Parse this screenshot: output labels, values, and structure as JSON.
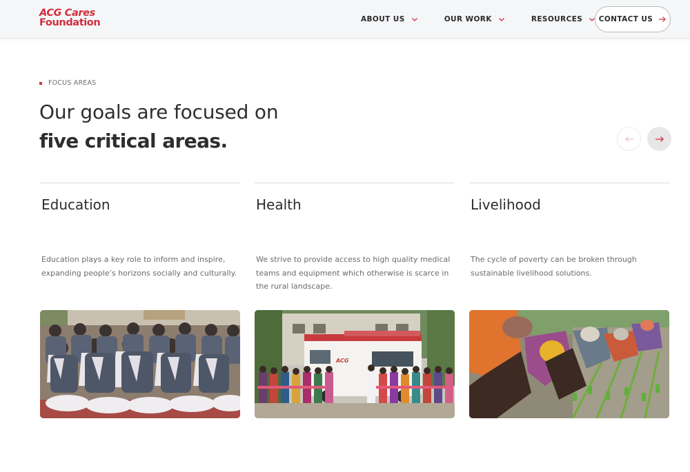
{
  "header": {
    "logo_line1": "ACG Cares",
    "logo_line2": "Foundation",
    "nav": [
      {
        "label": "ABOUT US"
      },
      {
        "label": "OUR WORK"
      },
      {
        "label": "RESOURCES"
      }
    ],
    "contact_label": "CONTACT US"
  },
  "section": {
    "eyebrow": "FOCUS AREAS",
    "headline_line1": "Our goals are focused on",
    "headline_line2": "five critical areas."
  },
  "cards": [
    {
      "title": "Education",
      "description": "Education plays a key role to inform and inspire, expanding people’s horizons socially and culturally.",
      "image": "students-seated-in-uniform-photo"
    },
    {
      "title": "Health",
      "description": "We strive to provide access to high quality medical teams and equipment which otherwise is scarce in the rural landscape.",
      "image": "mobile-medical-van-group-photo",
      "van_label": "ACG"
    },
    {
      "title": "Livelihood",
      "description": "The cycle of poverty can be broken through sustainable livelihood solutions.",
      "image": "women-planting-rice-field-photo"
    }
  ],
  "colors": {
    "brand_red": "#cf2e3d",
    "header_bg": "#f5f6f8",
    "text_dark": "#2e2e2e",
    "text_muted": "#6a6a6a"
  },
  "icons": {
    "nav_dropdown": "chevron-down-icon",
    "contact_arrow": "arrow-right-icon",
    "carousel_prev": "arrow-left-icon",
    "carousel_next": "arrow-right-icon"
  }
}
